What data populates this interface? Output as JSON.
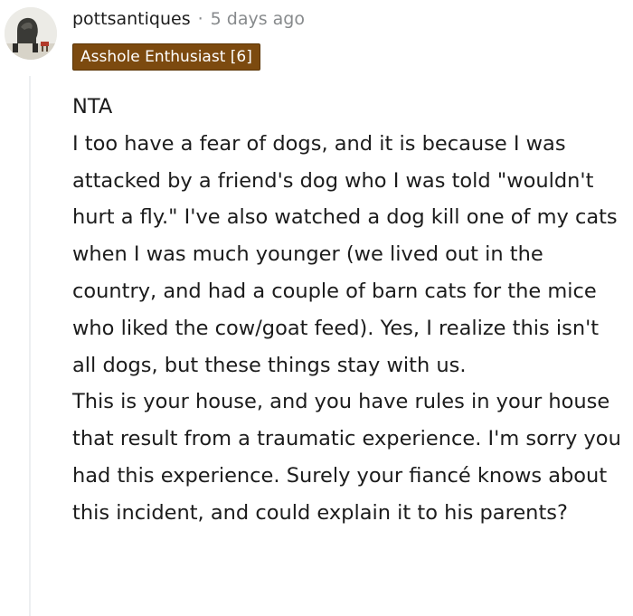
{
  "comment": {
    "username": "pottsantiques",
    "separator": "·",
    "timestamp": "5 days ago",
    "flair": "Asshole Enthusiast [6]",
    "paragraphs": [
      "NTA",
      "I too have a fear of dogs, and it is because I was attacked by a friend's dog who I was told \"wouldn't hurt a fly.\" I've also watched a dog kill one of my cats when I was much younger (we lived out in the country, and had a couple of barn cats for the mice who liked the cow/goat feed). Yes, I realize this isn't all dogs, but these things stay with us.",
      "This is your house, and you have rules in your house that result from a traumatic experience. I'm sorry you had this experience. Surely your fiancé knows about this incident, and could explain it to his parents?"
    ]
  },
  "colors": {
    "flair_background": "#7c4a0f",
    "flair_text": "#ffffff",
    "meta_gray": "#878a8c",
    "body_text": "#1c1c1c",
    "thread_line": "#edeff1"
  },
  "icons": {
    "avatar": "user-avatar-photo"
  }
}
